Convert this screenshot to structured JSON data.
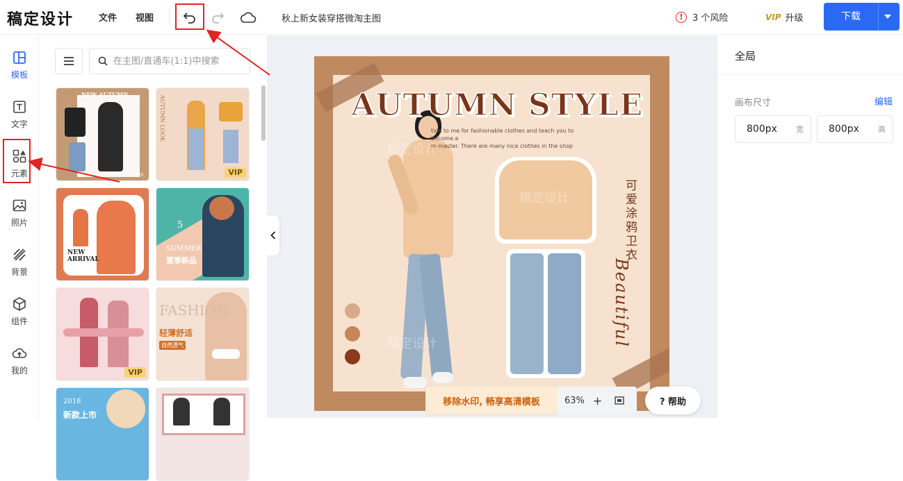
{
  "app": {
    "logo": "稿定设计"
  },
  "topbar": {
    "menu_file": "文件",
    "menu_view": "视图",
    "doc_title": "秋上新女装穿搭微淘主图",
    "risk_icon": "!",
    "risk_label": "3 个风险",
    "upgrade_icon": "VIP",
    "upgrade_label": "升级",
    "download_label": "下载",
    "icons": [
      "undo-icon",
      "redo-icon",
      "cloud-icon"
    ]
  },
  "leftnav": {
    "items": [
      {
        "label": "模板",
        "icon": "template-icon",
        "active": true
      },
      {
        "label": "文字",
        "icon": "text-icon"
      },
      {
        "label": "元素",
        "icon": "elements-icon"
      },
      {
        "label": "照片",
        "icon": "photo-icon"
      },
      {
        "label": "背景",
        "icon": "background-icon"
      },
      {
        "label": "组件",
        "icon": "component-icon"
      },
      {
        "label": "我的",
        "icon": "upload-cloud-icon"
      }
    ]
  },
  "panel": {
    "search_placeholder": "在主图/直通车(1:1)中搜索",
    "cards": [
      {
        "text": "NEW AUTUMN",
        "sub": "2020",
        "vip": false,
        "bg": "#c49a74"
      },
      {
        "text": "AUTUMN LOOK",
        "sub": "",
        "vip": true,
        "vip_label": "VIP",
        "bg": "#f3d9c8"
      },
      {
        "text": "NEW ARRIVAL",
        "sub": "",
        "vip": false,
        "bg": "#e07a52"
      },
      {
        "text": "SUMMER",
        "sub": "夏季新品",
        "badge": "5",
        "vip": false,
        "bg": "#4fb4a8"
      },
      {
        "text": "",
        "sub": "",
        "vip": true,
        "vip_label": "VIP",
        "bg": "#f6dcdc"
      },
      {
        "text": "FASHION",
        "sub": "轻薄舒适",
        "sub2": "自然透气",
        "vip": false,
        "bg": "#f4e2d4"
      },
      {
        "text": "2018",
        "sub": "新款上市",
        "vip": false,
        "bg": "#69b6e0"
      },
      {
        "text": "",
        "sub": "",
        "vip": false,
        "bg": "#f3e4e4"
      }
    ]
  },
  "canvas": {
    "headline": "AUTUMN STYLE",
    "subtext": "tion to me for fashionable clothes and teach you to become a\nm master. There are many nice clothes in the shop",
    "vertical_text": "可爱涂鸦卫衣",
    "script_text": "Beautiful",
    "watermark": "稿定设计",
    "swatches": [
      "#d8a98a",
      "#c88557",
      "#8a3a1c"
    ],
    "colors": {
      "frame": "#bf8a5f",
      "inner": "#f6e2cf",
      "headline": "#7a3519"
    }
  },
  "bottom": {
    "promo": "移除水印, 畅享高清模板",
    "zoom": "63%",
    "zoom_plus": "+",
    "help": "? 帮助"
  },
  "rightpanel": {
    "title": "全局",
    "canvas_size_label": "画布尺寸",
    "edit_label": "编辑",
    "width_value": "800px",
    "width_unit": "宽",
    "height_value": "800px",
    "height_unit": "高"
  },
  "accent": "#2a6af3",
  "annotation_color": "#e02424"
}
